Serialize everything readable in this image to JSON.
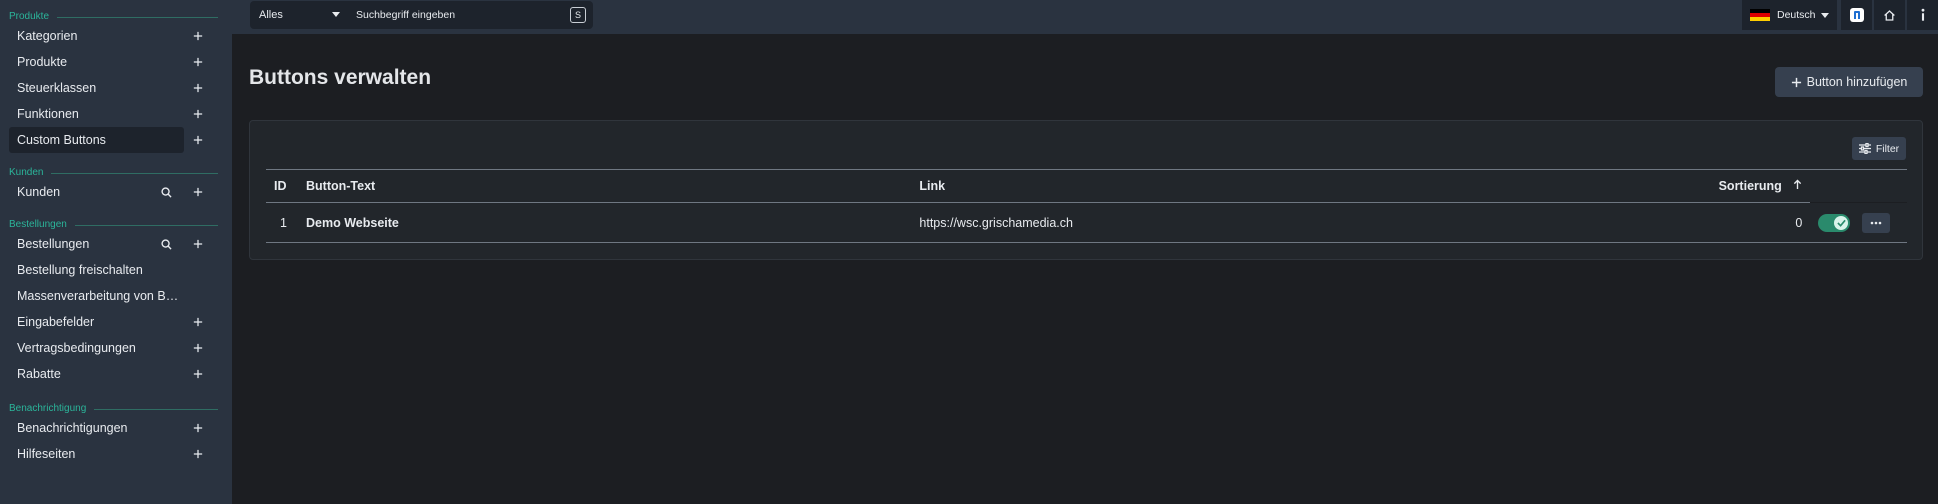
{
  "sidebar": {
    "sections": [
      {
        "label": "Produkte",
        "items": [
          {
            "label": "Kategorien",
            "search": false,
            "add": true,
            "active": false
          },
          {
            "label": "Produkte",
            "search": false,
            "add": true,
            "active": false
          },
          {
            "label": "Steuerklassen",
            "search": false,
            "add": true,
            "active": false
          },
          {
            "label": "Funktionen",
            "search": false,
            "add": true,
            "active": false
          },
          {
            "label": "Custom Buttons",
            "search": false,
            "add": true,
            "active": true
          }
        ]
      },
      {
        "label": "Kunden",
        "items": [
          {
            "label": "Kunden",
            "search": true,
            "add": true,
            "active": false
          }
        ]
      },
      {
        "label": "Bestellungen",
        "items": [
          {
            "label": "Bestellungen",
            "search": true,
            "add": true,
            "active": false
          },
          {
            "label": "Bestellung freischalten",
            "search": false,
            "add": false,
            "active": false
          },
          {
            "label": "Massenverarbeitung von Bestellu…",
            "search": false,
            "add": false,
            "active": false
          },
          {
            "label": "Eingabefelder",
            "search": false,
            "add": true,
            "active": false
          },
          {
            "label": "Vertragsbedingungen",
            "search": false,
            "add": true,
            "active": false
          },
          {
            "label": "Rabatte",
            "search": false,
            "add": true,
            "active": false
          }
        ]
      },
      {
        "label": "Benachrichtigung",
        "items": [
          {
            "label": "Benachrichtigungen",
            "search": false,
            "add": true,
            "active": false
          },
          {
            "label": "Hilfeseiten",
            "search": false,
            "add": true,
            "active": false
          }
        ]
      }
    ]
  },
  "topbar": {
    "scope": "Alles",
    "search_placeholder": "Suchbegriff eingeben",
    "shortcut": "S",
    "language": "Deutsch"
  },
  "main": {
    "title": "Buttons verwalten",
    "add_button": "Button hinzufügen",
    "filter_button": "Filter",
    "table": {
      "columns": {
        "id": "ID",
        "text": "Button-Text",
        "link": "Link",
        "sort": "Sortierung"
      },
      "rows": [
        {
          "id": "1",
          "text": "Demo Webseite",
          "link": "https://wsc.grischamedia.ch",
          "sort": "0",
          "enabled": true
        }
      ]
    }
  },
  "colors": {
    "accent": "#2bb59a",
    "toggle_on": "#2a8a6c",
    "sidebar_bg": "#2a3340",
    "page_bg": "#1c1e22"
  }
}
